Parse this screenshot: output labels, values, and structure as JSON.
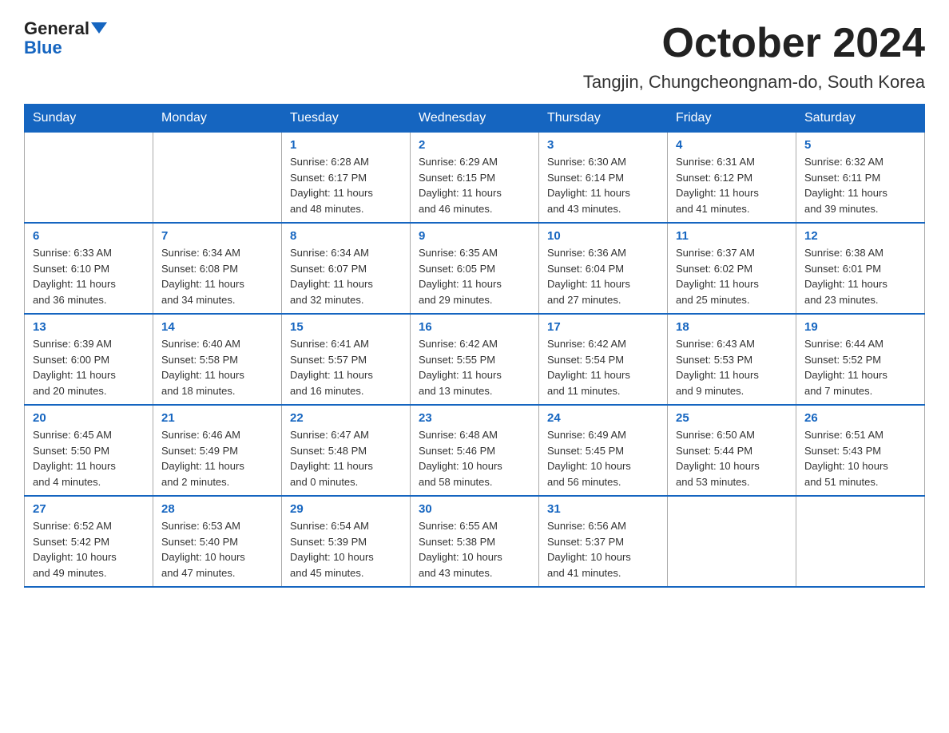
{
  "header": {
    "logo_general": "General",
    "logo_blue": "Blue",
    "month_title": "October 2024",
    "location": "Tangjin, Chungcheongnam-do, South Korea"
  },
  "weekdays": [
    "Sunday",
    "Monday",
    "Tuesday",
    "Wednesday",
    "Thursday",
    "Friday",
    "Saturday"
  ],
  "weeks": [
    [
      {
        "day": "",
        "info": ""
      },
      {
        "day": "",
        "info": ""
      },
      {
        "day": "1",
        "info": "Sunrise: 6:28 AM\nSunset: 6:17 PM\nDaylight: 11 hours\nand 48 minutes."
      },
      {
        "day": "2",
        "info": "Sunrise: 6:29 AM\nSunset: 6:15 PM\nDaylight: 11 hours\nand 46 minutes."
      },
      {
        "day": "3",
        "info": "Sunrise: 6:30 AM\nSunset: 6:14 PM\nDaylight: 11 hours\nand 43 minutes."
      },
      {
        "day": "4",
        "info": "Sunrise: 6:31 AM\nSunset: 6:12 PM\nDaylight: 11 hours\nand 41 minutes."
      },
      {
        "day": "5",
        "info": "Sunrise: 6:32 AM\nSunset: 6:11 PM\nDaylight: 11 hours\nand 39 minutes."
      }
    ],
    [
      {
        "day": "6",
        "info": "Sunrise: 6:33 AM\nSunset: 6:10 PM\nDaylight: 11 hours\nand 36 minutes."
      },
      {
        "day": "7",
        "info": "Sunrise: 6:34 AM\nSunset: 6:08 PM\nDaylight: 11 hours\nand 34 minutes."
      },
      {
        "day": "8",
        "info": "Sunrise: 6:34 AM\nSunset: 6:07 PM\nDaylight: 11 hours\nand 32 minutes."
      },
      {
        "day": "9",
        "info": "Sunrise: 6:35 AM\nSunset: 6:05 PM\nDaylight: 11 hours\nand 29 minutes."
      },
      {
        "day": "10",
        "info": "Sunrise: 6:36 AM\nSunset: 6:04 PM\nDaylight: 11 hours\nand 27 minutes."
      },
      {
        "day": "11",
        "info": "Sunrise: 6:37 AM\nSunset: 6:02 PM\nDaylight: 11 hours\nand 25 minutes."
      },
      {
        "day": "12",
        "info": "Sunrise: 6:38 AM\nSunset: 6:01 PM\nDaylight: 11 hours\nand 23 minutes."
      }
    ],
    [
      {
        "day": "13",
        "info": "Sunrise: 6:39 AM\nSunset: 6:00 PM\nDaylight: 11 hours\nand 20 minutes."
      },
      {
        "day": "14",
        "info": "Sunrise: 6:40 AM\nSunset: 5:58 PM\nDaylight: 11 hours\nand 18 minutes."
      },
      {
        "day": "15",
        "info": "Sunrise: 6:41 AM\nSunset: 5:57 PM\nDaylight: 11 hours\nand 16 minutes."
      },
      {
        "day": "16",
        "info": "Sunrise: 6:42 AM\nSunset: 5:55 PM\nDaylight: 11 hours\nand 13 minutes."
      },
      {
        "day": "17",
        "info": "Sunrise: 6:42 AM\nSunset: 5:54 PM\nDaylight: 11 hours\nand 11 minutes."
      },
      {
        "day": "18",
        "info": "Sunrise: 6:43 AM\nSunset: 5:53 PM\nDaylight: 11 hours\nand 9 minutes."
      },
      {
        "day": "19",
        "info": "Sunrise: 6:44 AM\nSunset: 5:52 PM\nDaylight: 11 hours\nand 7 minutes."
      }
    ],
    [
      {
        "day": "20",
        "info": "Sunrise: 6:45 AM\nSunset: 5:50 PM\nDaylight: 11 hours\nand 4 minutes."
      },
      {
        "day": "21",
        "info": "Sunrise: 6:46 AM\nSunset: 5:49 PM\nDaylight: 11 hours\nand 2 minutes."
      },
      {
        "day": "22",
        "info": "Sunrise: 6:47 AM\nSunset: 5:48 PM\nDaylight: 11 hours\nand 0 minutes."
      },
      {
        "day": "23",
        "info": "Sunrise: 6:48 AM\nSunset: 5:46 PM\nDaylight: 10 hours\nand 58 minutes."
      },
      {
        "day": "24",
        "info": "Sunrise: 6:49 AM\nSunset: 5:45 PM\nDaylight: 10 hours\nand 56 minutes."
      },
      {
        "day": "25",
        "info": "Sunrise: 6:50 AM\nSunset: 5:44 PM\nDaylight: 10 hours\nand 53 minutes."
      },
      {
        "day": "26",
        "info": "Sunrise: 6:51 AM\nSunset: 5:43 PM\nDaylight: 10 hours\nand 51 minutes."
      }
    ],
    [
      {
        "day": "27",
        "info": "Sunrise: 6:52 AM\nSunset: 5:42 PM\nDaylight: 10 hours\nand 49 minutes."
      },
      {
        "day": "28",
        "info": "Sunrise: 6:53 AM\nSunset: 5:40 PM\nDaylight: 10 hours\nand 47 minutes."
      },
      {
        "day": "29",
        "info": "Sunrise: 6:54 AM\nSunset: 5:39 PM\nDaylight: 10 hours\nand 45 minutes."
      },
      {
        "day": "30",
        "info": "Sunrise: 6:55 AM\nSunset: 5:38 PM\nDaylight: 10 hours\nand 43 minutes."
      },
      {
        "day": "31",
        "info": "Sunrise: 6:56 AM\nSunset: 5:37 PM\nDaylight: 10 hours\nand 41 minutes."
      },
      {
        "day": "",
        "info": ""
      },
      {
        "day": "",
        "info": ""
      }
    ]
  ]
}
